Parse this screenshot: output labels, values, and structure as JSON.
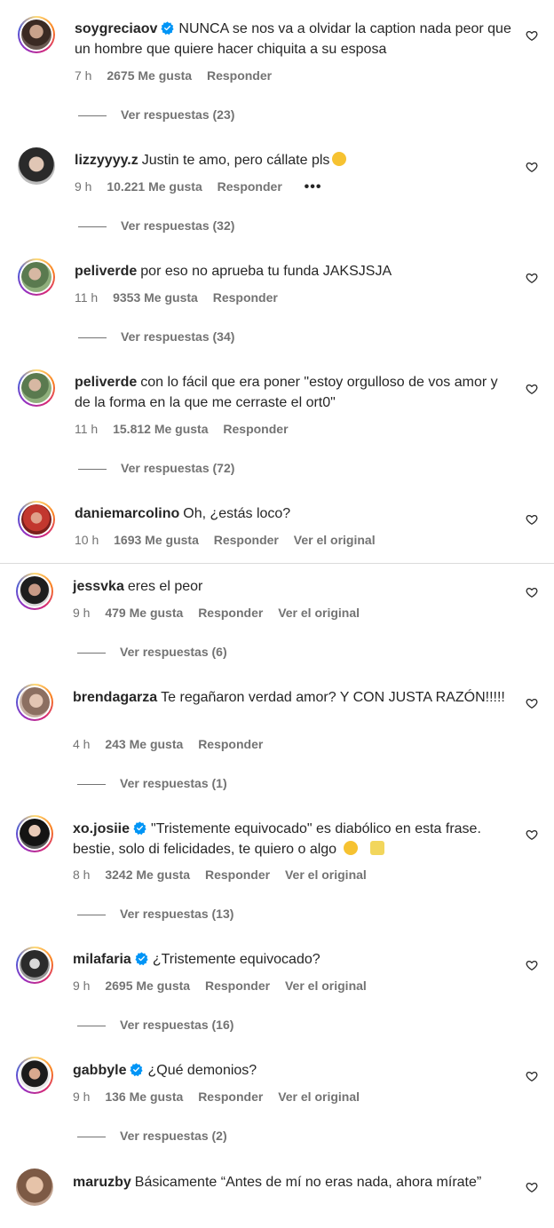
{
  "comments": [
    {
      "user": "soygreciaov",
      "verified": true,
      "text": "NUNCA se nos va a olvidar la caption nada peor que un hombre que quiere hacer chiquita a su esposa",
      "time": "7 h",
      "likes": "2675 Me gusta",
      "reply": "Responder",
      "view_replies": "Ver respuestas (23)"
    },
    {
      "user": "lizzyyyy.z",
      "verified": false,
      "text": "Justin te amo, pero cállate pls",
      "time": "9 h",
      "likes": "10.221 Me gusta",
      "reply": "Responder",
      "more": "•••",
      "view_replies": "Ver respuestas (32)"
    },
    {
      "user": "peliverde",
      "verified": false,
      "text": "por eso no aprueba tu funda JAKSJSJA",
      "time": "11 h",
      "likes": "9353 Me gusta",
      "reply": "Responder",
      "view_replies": "Ver respuestas (34)"
    },
    {
      "user": "peliverde",
      "verified": false,
      "text": "con lo fácil que era poner \"estoy orgulloso de vos amor y de la forma en la que me cerraste el ort0\"",
      "time": "11 h",
      "likes": "15.812 Me gusta",
      "reply": "Responder",
      "view_replies": "Ver respuestas (72)"
    },
    {
      "user": "daniemarcolino",
      "verified": false,
      "text": "Oh, ¿estás loco?",
      "time": "10 h",
      "likes": "1693 Me gusta",
      "reply": "Responder",
      "original": "Ver el original"
    },
    {
      "user": "jessvka",
      "verified": false,
      "text": "eres el peor",
      "time": "9 h",
      "likes": "479 Me gusta",
      "reply": "Responder",
      "original": "Ver el original",
      "view_replies": "Ver respuestas (6)"
    },
    {
      "user": "brendagarza",
      "verified": false,
      "text": "Te regañaron verdad amor? Y CON JUSTA RAZÓN!!!!!",
      "time": "4 h",
      "likes": "243 Me gusta",
      "reply": "Responder",
      "view_replies": "Ver respuestas (1)"
    },
    {
      "user": "xo.josiie",
      "verified": true,
      "text": "\"Tristemente equivocado\" es diabólico en esta frase. bestie, solo di felicidades, te quiero o algo",
      "time": "8 h",
      "likes": "3242 Me gusta",
      "reply": "Responder",
      "original": "Ver el original",
      "view_replies": "Ver respuestas (13)"
    },
    {
      "user": "milafaria",
      "verified": true,
      "text": "¿Tristemente equivocado?",
      "time": "9 h",
      "likes": "2695 Me gusta",
      "reply": "Responder",
      "original": "Ver el original",
      "view_replies": "Ver respuestas (16)"
    },
    {
      "user": "gabbyle",
      "verified": true,
      "text": "¿Qué demonios?",
      "time": "9 h",
      "likes": "136 Me gusta",
      "reply": "Responder",
      "original": "Ver el original",
      "view_replies": "Ver respuestas (2)"
    },
    {
      "user": "maruzby",
      "verified": false,
      "text": "Básicamente “Antes de mí no eras nada, ahora mírate”"
    }
  ],
  "colors": {
    "verified": "#0095f6",
    "muted": "#737373",
    "text": "#262626",
    "ring": "#d62976"
  },
  "icons": {
    "like": "heart-icon",
    "verified": "verified-badge-icon"
  }
}
